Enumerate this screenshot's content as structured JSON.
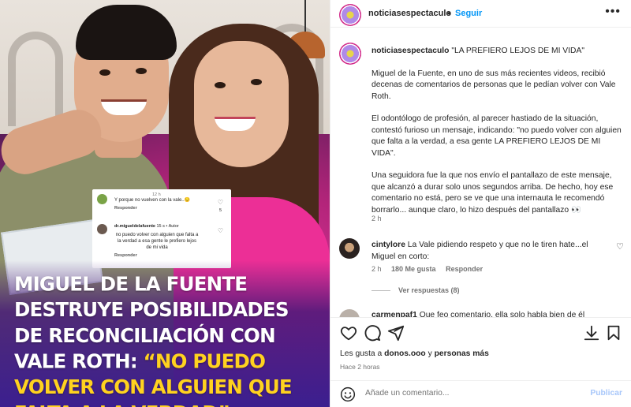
{
  "post_image": {
    "overlay_comment_1": {
      "time": "12 h",
      "text": "Y porque no vuelven con la vale..😔",
      "reply": "Responder",
      "likes": "5"
    },
    "overlay_comment_2": {
      "author": "dr.migueldelafuente",
      "meta": "15 s • Autor",
      "text": "no puedo volver con alguien que falta a la verdad a esa gente le prefiero lejos de mi vida",
      "reply": "Responder"
    },
    "headline_white": "MIGUEL DE LA FUENTE DESTRUYE POSIBILIDADES DE RECONCILIACIÓN CON VALE ROTH: ",
    "headline_yellow": "“NO PUEDO VOLVER CON ALGUIEN QUE FALTA A LA VERDAD”"
  },
  "header": {
    "username": "noticiasespectaculo",
    "dot": "•",
    "follow_label": "Seguir",
    "more": "•••"
  },
  "caption": {
    "username": "noticiasespectaculo",
    "title": "\"LA PREFIERO LEJOS DE MI VIDA\"",
    "p1": "Miguel de la Fuente, en uno de sus más recientes videos, recibió decenas de comentarios de personas que le pedían volver con Vale Roth.",
    "p2": "El odontólogo de profesión, al parecer hastiado de la situación, contestó furioso un mensaje, indicando: \"no puedo volver con alguien que falta a la verdad, a esa gente LA PREFIERO LEJOS DE MI VIDA\".",
    "p3": "Una seguidora fue la que nos envío el pantallazo de este mensaje, que alcanzó a durar solo unos segundos arriba. De hecho, hoy ese comentario no está, pero se ve que una internauta le recomendó borrarlo... aunque claro, lo hizo después del pantallazo 👀",
    "time": "2 h"
  },
  "comments": [
    {
      "username": "cintylore",
      "text": "La Vale pidiendo respeto y que no le tiren hate...el Miguel en corto:",
      "time": "2 h",
      "likes": "180 Me gusta",
      "reply": "Responder",
      "replies_label": "Ver respuestas (8)"
    },
    {
      "username": "carmenpaf1",
      "text": "Que feo comentario, ella solo habla bien de él"
    }
  ],
  "footer": {
    "likes_prefix": "Les gusta a ",
    "likes_user": "donos.ooo",
    "likes_middle": " y ",
    "likes_others": "personas más",
    "ago": "Hace 2 horas",
    "add_comment_placeholder": "Añade un comentario...",
    "publish_label": "Publicar"
  }
}
